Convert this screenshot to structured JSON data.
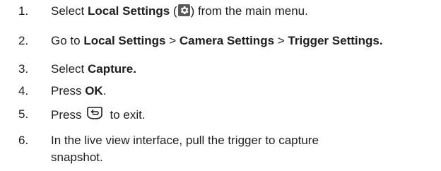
{
  "steps": [
    {
      "number": "1.",
      "parts": {
        "pre": "Select ",
        "bold1": "Local Settings",
        "mid": " (",
        "icon": "gear-icon",
        "post": ") from the main menu."
      }
    },
    {
      "number": "2.",
      "parts": {
        "pre": "Go to ",
        "bold1": "Local Settings",
        "sep1": " > ",
        "bold2": "Camera Settings",
        "sep2": " > ",
        "bold3": "Trigger Settings."
      }
    },
    {
      "number": "3.",
      "parts": {
        "pre": "Select ",
        "bold1": "Capture."
      }
    },
    {
      "number": "4.",
      "parts": {
        "pre": "Press ",
        "bold1": "OK",
        "post": "."
      }
    },
    {
      "number": "5.",
      "parts": {
        "pre": "Press",
        "icon": "back-button-icon",
        "post": "to exit."
      }
    },
    {
      "number": "6.",
      "parts": {
        "line1": "In the live view interface, pull the trigger to capture",
        "line2": "snapshot."
      }
    }
  ]
}
